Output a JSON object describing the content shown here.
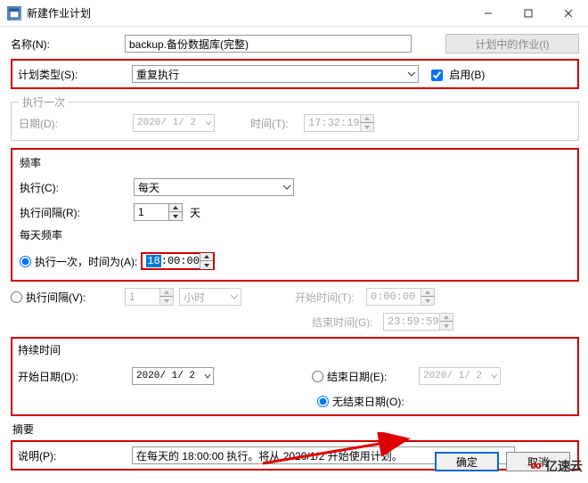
{
  "window": {
    "title": "新建作业计划"
  },
  "name": {
    "label": "名称(N):",
    "value": "backup.备份数据库(完整)"
  },
  "disabled_button": "计划中的作业(I)",
  "plan_type": {
    "label": "计划类型(S):",
    "value": "重复执行",
    "enable_label": "启用(B)"
  },
  "once": {
    "legend": "执行一次",
    "date_label": "日期(D):",
    "date_value": "2020/ 1/ 2",
    "time_label": "时间(T):",
    "time_value": "17:32:19"
  },
  "freq": {
    "legend": "频率",
    "exec_label": "执行(C):",
    "exec_value": "每天",
    "interval_label": "执行间隔(R):",
    "interval_value": "1",
    "interval_unit": "天"
  },
  "daily": {
    "legend": "每天频率",
    "once_label": "执行一次，时间为(A):",
    "once_hour": "18",
    "once_rest": ":00:00",
    "interval_label": "执行间隔(V):",
    "interval_value": "1",
    "interval_unit": "小时",
    "start_label": "开始时间(T):",
    "start_value": "0:00:00",
    "end_label": "结束时间(G):",
    "end_value": "23:59:59"
  },
  "duration": {
    "legend": "持续时间",
    "start_label": "开始日期(D):",
    "start_value": "2020/ 1/ 2",
    "end_date_label": "结束日期(E):",
    "end_date_value": "2020/ 1/ 2",
    "no_end_label": "无结束日期(O):"
  },
  "summary": {
    "legend": "摘要",
    "label": "说明(P):",
    "text": "在每天的 18:00:00 执行。将从 2020/1/2 开始使用计划。"
  },
  "buttons": {
    "ok": "确定",
    "cancel": "取消"
  },
  "watermark": "亿速云"
}
